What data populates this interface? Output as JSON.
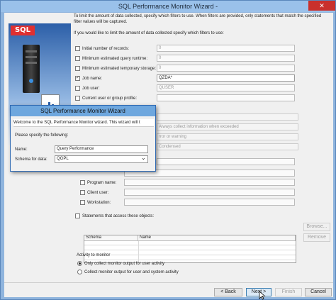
{
  "window": {
    "title": "SQL Performance Monitor Wizard -",
    "close_glyph": "✕"
  },
  "art": {
    "logo_text": "SQL"
  },
  "intro": "To limit the amount of data collected, specify which filters to use.  When filters are provided, only statements that match the specified filter values will be captured.",
  "question": "If you would like to limit the amount of data collected specify which filters to use:",
  "filters": [
    {
      "label": "Initial number of records:",
      "checked": false,
      "value": "0"
    },
    {
      "label": "Minimum estimated query runtime:",
      "checked": false,
      "value": "0"
    },
    {
      "label": "Minimum estimated temporary storage:",
      "checked": false,
      "value": "0"
    },
    {
      "label": "Job name:",
      "checked": true,
      "value": "QZDA*"
    },
    {
      "label": "Job user:",
      "checked": false,
      "value": "QUSER"
    },
    {
      "label": "Current user or group profile:",
      "checked": false,
      "value": ""
    }
  ],
  "dropdowns": [
    {
      "value": ""
    },
    {
      "value": "Always collect information when exceeded"
    },
    {
      "value": "rror or warning"
    },
    {
      "value": "Condensed"
    }
  ],
  "more_filters": [
    {
      "label": "Program name:",
      "checked": false
    },
    {
      "label": "Client user:",
      "checked": false
    },
    {
      "label": "Workstation:",
      "checked": false
    }
  ],
  "objects": {
    "label": "Statements that access these objects:",
    "columns": [
      "Schema",
      "Name"
    ],
    "browse": "Browse...",
    "remove": "Remove"
  },
  "activity": {
    "title": "Activity to monitor",
    "options": [
      {
        "label": "Only collect monitor output for user activity",
        "selected": true
      },
      {
        "label": "Collect monitor output for user and system activity",
        "selected": false
      }
    ]
  },
  "nav": {
    "back": "< Back",
    "next": "Next >",
    "finish": "Finish",
    "cancel": "Cancel"
  },
  "dialog": {
    "title": "SQL Performance Monitor Wizard",
    "welcome": "Welcome to the SQL Performance Monitor wizard.  This wizard will t",
    "prompt": "Please specify the following:",
    "name_label": "Name:",
    "name_value": "Query Performance",
    "schema_label": "Schema for data:",
    "schema_value": "QGPL",
    "chevron": "⌄"
  }
}
